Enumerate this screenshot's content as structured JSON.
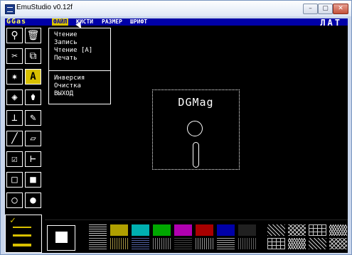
{
  "window": {
    "title": "EmuStudio v0.12f",
    "controls": [
      "–",
      "▢",
      "✕"
    ]
  },
  "menubar": {
    "logo": "GGas",
    "items": [
      "ФАЙЛ",
      "КИСТИ",
      "РАЗМЕР",
      "ШРИФТ"
    ],
    "lang": "ЛАТ"
  },
  "file_menu": {
    "items": [
      "Чтение",
      "Запись",
      "Чтение [A]",
      "Печать",
      "Инверсия",
      "Очистка",
      "ВЫХОД"
    ]
  },
  "toolbox": {
    "tools": [
      {
        "name": "magnifier-icon",
        "glyph": "⚲"
      },
      {
        "name": "trash-icon",
        "glyph": "🗑"
      },
      {
        "name": "scissors-icon",
        "glyph": "✂"
      },
      {
        "name": "copy-icon",
        "glyph": "⧉"
      },
      {
        "name": "spray-icon",
        "glyph": "✷"
      },
      {
        "name": "text-tool-icon",
        "glyph": "A"
      },
      {
        "name": "fill-bucket-icon",
        "glyph": "◈"
      },
      {
        "name": "bottle-icon",
        "glyph": "⚱"
      },
      {
        "name": "stamp-icon",
        "glyph": "⊥"
      },
      {
        "name": "pencil-icon",
        "glyph": "✎"
      },
      {
        "name": "line-icon",
        "glyph": "╱"
      },
      {
        "name": "eraser-icon",
        "glyph": "▱"
      },
      {
        "name": "polygon-icon",
        "glyph": "☑"
      },
      {
        "name": "line-width-icon",
        "glyph": "⊢"
      },
      {
        "name": "rectangle-icon",
        "glyph": "□"
      },
      {
        "name": "filled-rectangle-icon",
        "glyph": "■"
      },
      {
        "name": "circle-icon",
        "glyph": "○"
      },
      {
        "name": "filled-circle-icon",
        "glyph": "●"
      }
    ]
  },
  "canvas": {
    "disk_label": "DGMag"
  },
  "colors": {
    "accent": "#d8c000",
    "menu_bg": "#0000a8",
    "canvas_bg": "#000000"
  },
  "palette": {
    "top": [
      "#c0c0c0",
      "#b0a000",
      "#00b0b0",
      "#00a800",
      "#b000b0",
      "#a80000",
      "#0000a8",
      "#202020"
    ],
    "bottom": [
      "#a0a0a0",
      "#a09040",
      "#5060a0",
      "#808080",
      "#404040",
      "#909090",
      "#a0a0a0",
      "#606060"
    ],
    "patterns": [
      "diagonal-pattern-icon",
      "cross-pattern-icon",
      "brick-pattern-icon",
      "weave-pattern-icon"
    ]
  }
}
